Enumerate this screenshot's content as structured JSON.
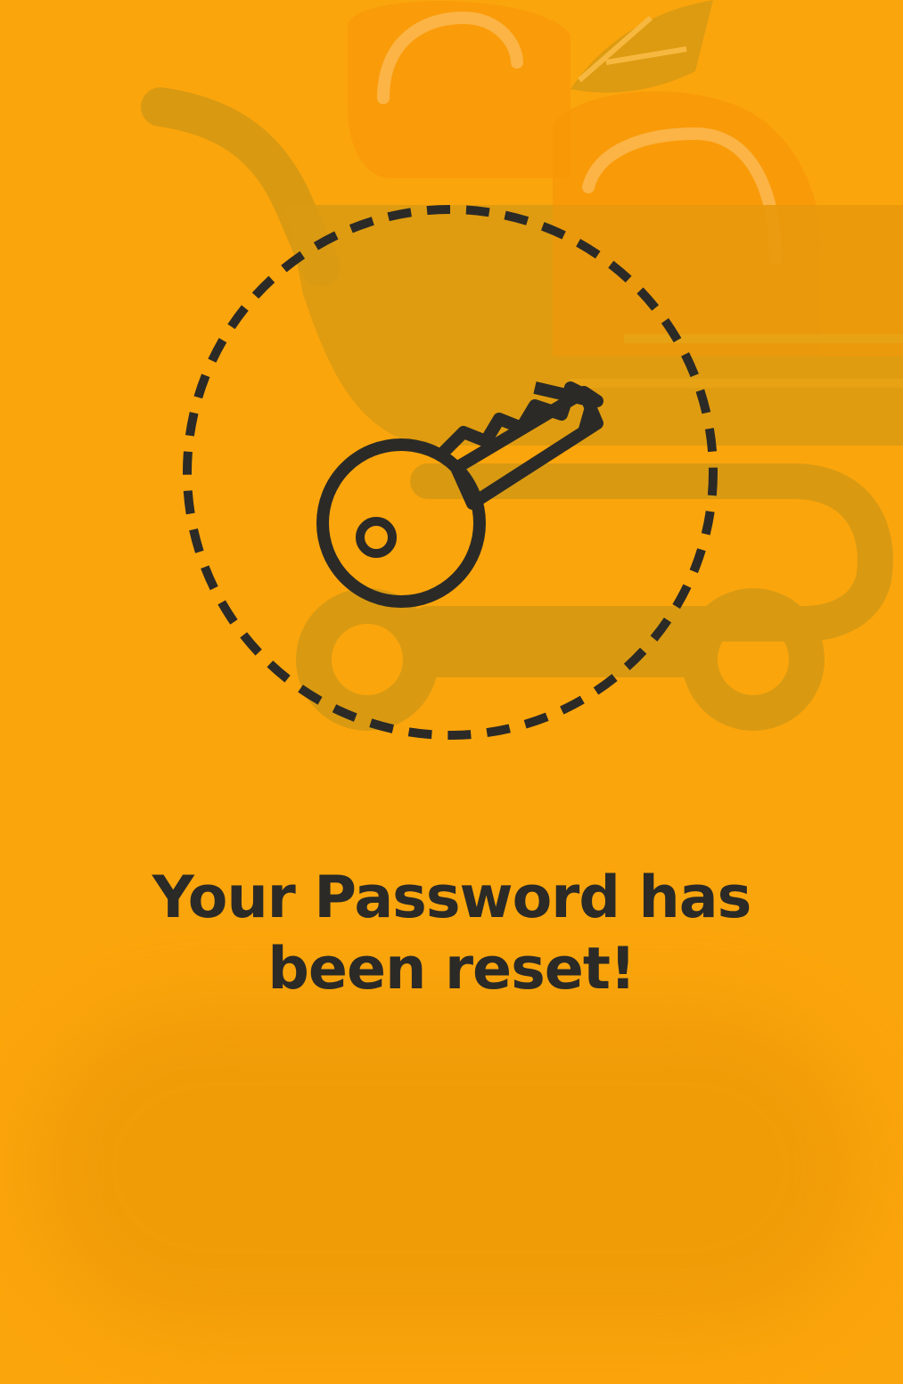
{
  "screen": {
    "message_line1": "Your Password has",
    "message_line2": "been reset!"
  },
  "icons": {
    "key": "key-icon",
    "badge": "dashed-circle",
    "background": "grocery-cart-illustration"
  },
  "colors": {
    "background": "#fba50c",
    "ink": "#2b2a26",
    "watermark": "#d99a12",
    "accent_fruit": "#f99708"
  }
}
